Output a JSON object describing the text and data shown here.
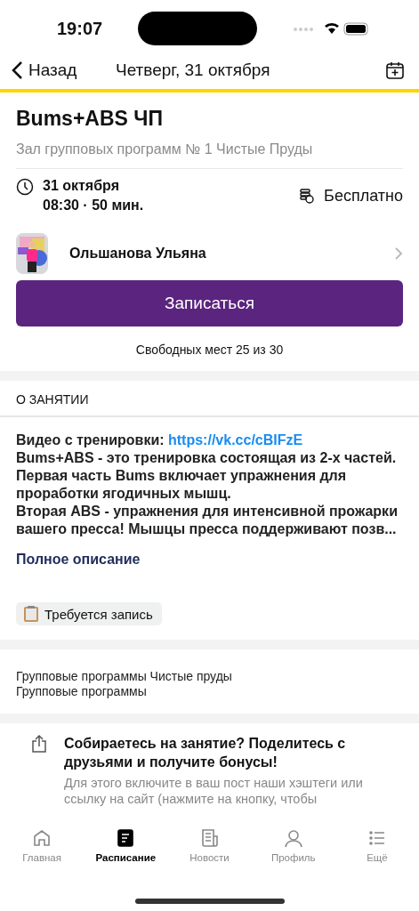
{
  "status_bar": {
    "time": "19:07"
  },
  "nav": {
    "back": "Назад",
    "title": "Четверг, 31 октября"
  },
  "event": {
    "title": "Bums+ABS ЧП",
    "venue": "Зал групповых программ № 1 Чистые Пруды",
    "date": "31 октября",
    "time": "08:30 · 50 мин.",
    "price": "Бесплатно"
  },
  "trainer": {
    "name": "Ольшанова Ульяна"
  },
  "signup_button": "Записаться",
  "free_places": "Свободных мест 25 из 30",
  "about": {
    "header": "О ЗАНЯТИИ",
    "video_label": "Видео с тренировки: ",
    "video_link": "https://vk.cc/cBIFzE",
    "lines": [
      "Bums+ABS - это тренировка состоящая из 2-х частей.",
      "Первая часть Bums включает упражнения для проработки ягодичных мышц.",
      "Вторая ABS - упражнения для интенсивной прожарки вашего пресса!  Мышцы пресса поддерживают позв..."
    ],
    "more": "Полное описание",
    "tag": "Требуется запись"
  },
  "categories": [
    "Групповые программы Чистые пруды",
    "Групповые программы"
  ],
  "share": {
    "title": "Собираетесь на занятие? Поделитесь с друзьями и получите бонусы!",
    "text": "Для этого включите в ваш пост наши хэштеги или ссылку на сайт (нажмите на кнопку, чтобы"
  },
  "tabs": [
    {
      "label": "Главная",
      "kind": "home",
      "selected": false
    },
    {
      "label": "Расписание",
      "kind": "schedule",
      "selected": true
    },
    {
      "label": "Новости",
      "kind": "news",
      "selected": false
    },
    {
      "label": "Профиль",
      "kind": "profile",
      "selected": false
    },
    {
      "label": "Ещё",
      "kind": "more",
      "selected": false
    }
  ]
}
